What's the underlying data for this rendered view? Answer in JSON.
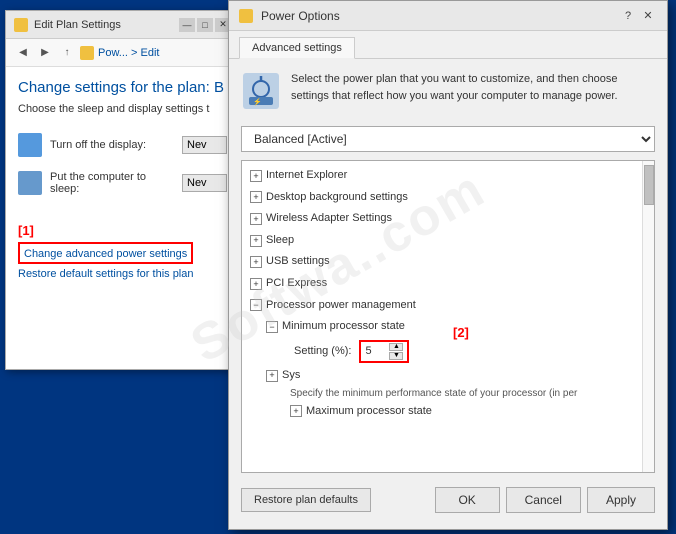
{
  "editPlanWindow": {
    "title": "Edit Plan Settings",
    "breadcrumb": "Pow... > Edit",
    "heading": "Change settings for the plan: B",
    "subtext": "Choose the sleep and display settings t",
    "settings": [
      {
        "label": "Turn off the display:",
        "value": "Nev"
      },
      {
        "label": "Put the computer to sleep:",
        "value": "Nev"
      }
    ],
    "linkLabel1Number": "[1]",
    "changeAdvancedLink": "Change advanced power settings",
    "restoreDefaultLink": "Restore default settings for this plan"
  },
  "powerOptionsDialog": {
    "title": "Power Options",
    "helpBtn": "?",
    "closeBtn": "✕",
    "tab": "Advanced settings",
    "infoText": "Select the power plan that you want to customize, and then choose settings that reflect how you want your computer to manage power.",
    "planDropdown": "Balanced [Active]",
    "treeItems": [
      {
        "label": "Internet Explorer",
        "level": 1,
        "expand": "+"
      },
      {
        "label": "Desktop background settings",
        "level": 1,
        "expand": "+"
      },
      {
        "label": "Wireless Adapter Settings",
        "level": 1,
        "expand": "+"
      },
      {
        "label": "Sleep",
        "level": 1,
        "expand": "+"
      },
      {
        "label": "USB settings",
        "level": 1,
        "expand": "+"
      },
      {
        "label": "PCI Express",
        "level": 1,
        "expand": "+"
      },
      {
        "label": "Processor power management",
        "level": 1,
        "expand": "−"
      },
      {
        "label": "Minimum processor state",
        "level": 2,
        "expand": "−"
      },
      {
        "label": "Setting (%): 5",
        "level": 3,
        "isInput": true
      },
      {
        "label": "Sys",
        "level": 1,
        "expand": "+"
      },
      {
        "label": "Maximum processor state",
        "level": 2,
        "expand": "+"
      }
    ],
    "specifyText": "Specify the minimum performance state of your processor (in per",
    "settingLabel": "Setting (%):",
    "settingValue": "5",
    "label2": "[2]",
    "restorePlanBtn": "Restore plan defaults",
    "okBtn": "OK",
    "cancelBtn": "Cancel",
    "applyBtn": "Apply"
  },
  "watermark": "Softwa..com"
}
